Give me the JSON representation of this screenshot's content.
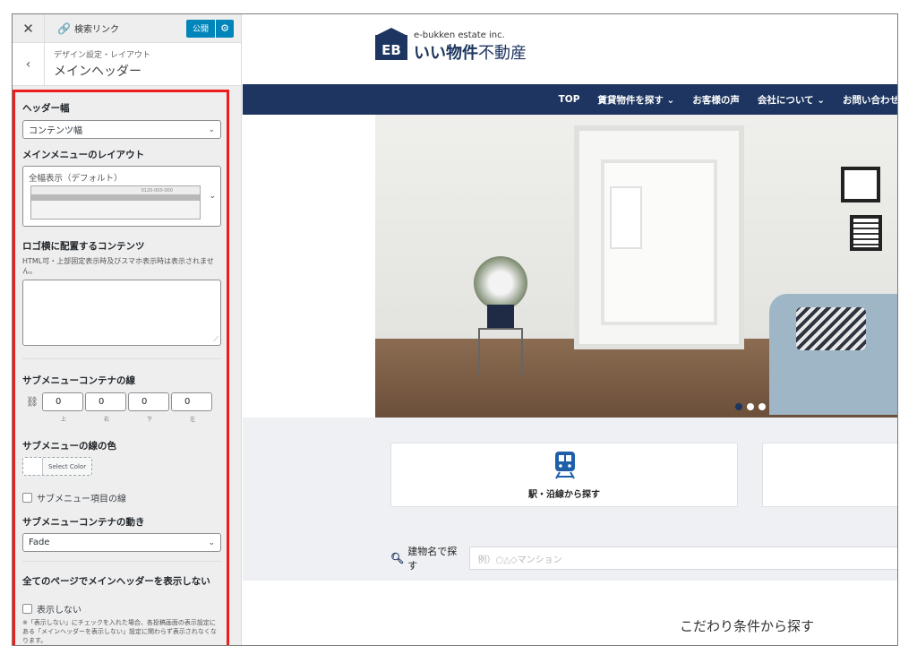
{
  "sidebar": {
    "close_glyph": "✕",
    "link_text": "検索リンク",
    "publish_label": "公開",
    "back_glyph": "‹",
    "breadcrumb": "デザイン設定・レイアウト",
    "section_title": "メインヘッダー",
    "controls": {
      "header_width": {
        "title": "ヘッダー幅",
        "value": "コンテンツ幅"
      },
      "menu_layout": {
        "title": "メインメニューのレイアウト",
        "value": "全幅表示（デフォルト）",
        "preview_phone": "0120-000-000"
      },
      "logo_side": {
        "title": "ロゴ横に配置するコンテンツ",
        "help": "HTML可・上部固定表示時及びスマホ表示時は表示されません。"
      },
      "submenu_border": {
        "title": "サブメニューコンテナの線",
        "values": [
          "0",
          "0",
          "0",
          "0"
        ],
        "labels": [
          "上",
          "右",
          "下",
          "左"
        ]
      },
      "submenu_color": {
        "title": "サブメニューの線の色",
        "button_label": "Select Color"
      },
      "submenu_item_border": {
        "label": "サブメニュー項目の線"
      },
      "submenu_motion": {
        "title": "サブメニューコンテナの動き",
        "value": "Fade"
      },
      "hide_header": {
        "title": "全てのページでメインヘッダーを表示しない",
        "checkbox_label": "表示しない",
        "note": "※「表示しない」にチェックを入れた場合、各投稿画面の表示設定にある「メインヘッダーを表示しない」設定に関わらず表示されなくなります。"
      }
    }
  },
  "preview": {
    "logo": {
      "mark": "EB",
      "sub": "e-bukken estate inc.",
      "main_bold": "いい物件",
      "main_rest": "不動産"
    },
    "nav": [
      "TOP",
      "賃貸物件を探す ⌄",
      "お客様の声",
      "会社について ⌄",
      "お問い合わせ"
    ],
    "card_label": "駅・沿線から探す",
    "search_label": "建物名で探す",
    "search_placeholder": "例）○△◇マンション",
    "lower_title": "こだわり条件から探す",
    "carousel": {
      "slides": 3,
      "active": 1
    }
  },
  "colors": {
    "accent": "#0085ba",
    "brand": "#1d3560",
    "highlight": "#ee1c1c"
  }
}
